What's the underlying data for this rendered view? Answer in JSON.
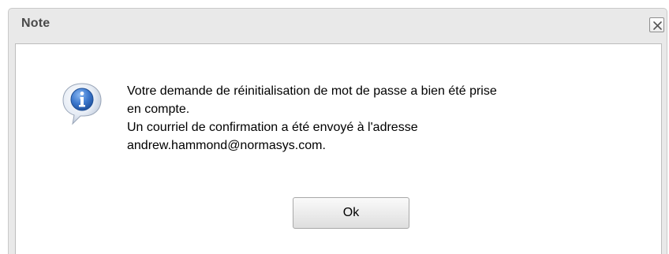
{
  "dialog": {
    "title": "Note",
    "close_icon": "close-icon",
    "info_icon": "info-icon",
    "message_lines": [
      "Votre demande de réinitialisation de mot de passe a bien été prise",
      "en compte.",
      "Un courriel de confirmation a été envoyé à l'adresse",
      "andrew.hammond@normasys.com."
    ],
    "ok_label": "Ok"
  },
  "colors": {
    "titlebar_bg": "#e9e9e9",
    "title_text": "#4a4a4a",
    "content_bg": "#ffffff",
    "icon_blue": "#2e6cc0"
  }
}
